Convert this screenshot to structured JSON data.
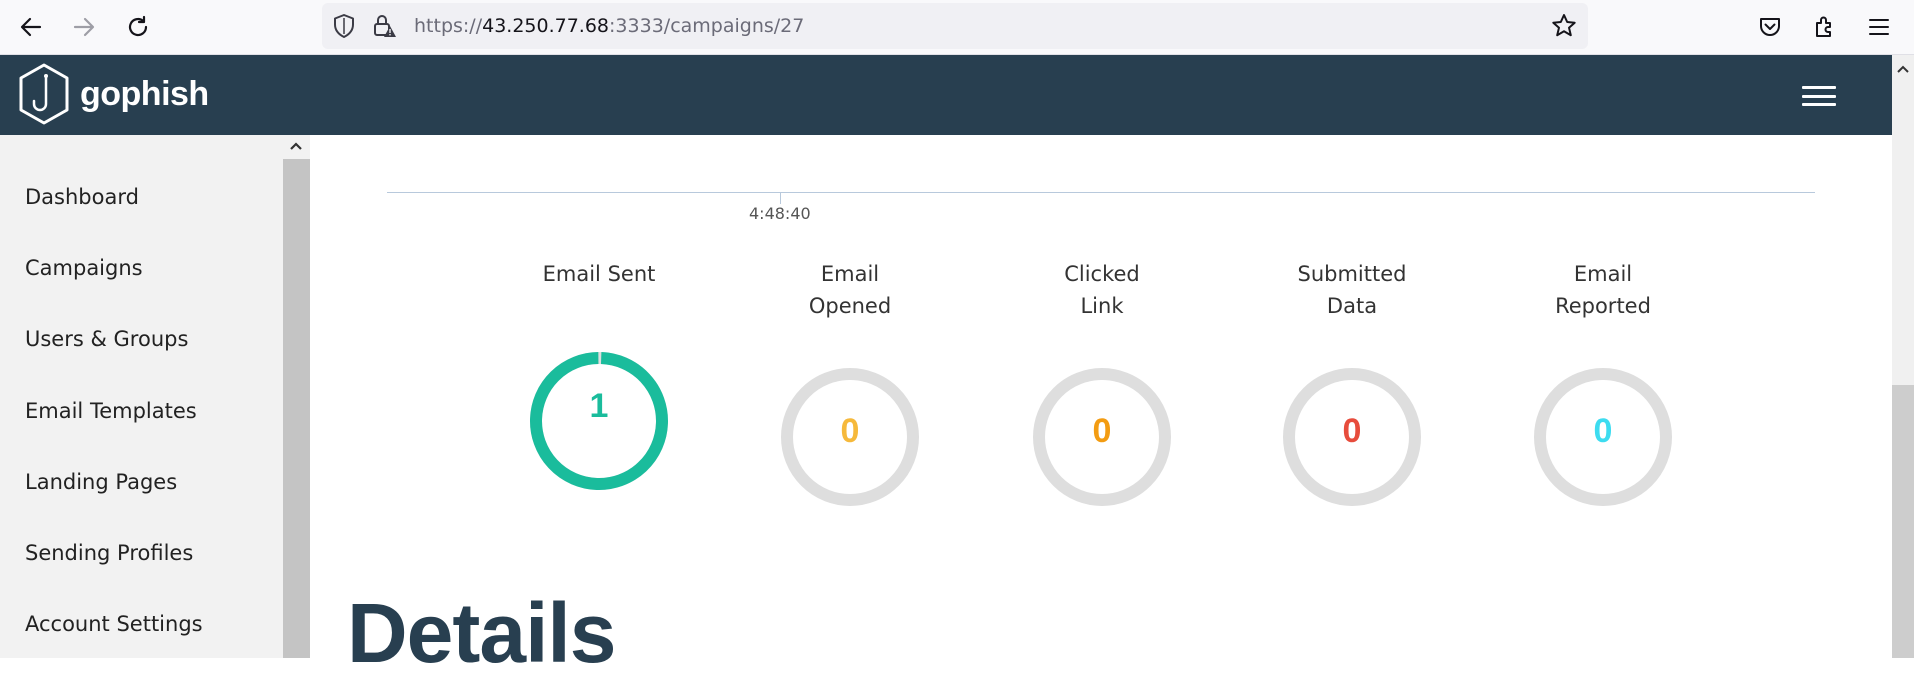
{
  "browser": {
    "url_scheme": "https://",
    "url_host": "43.250.77.68",
    "url_rest": ":3333/campaigns/27"
  },
  "app": {
    "brand": "gophish"
  },
  "sidebar": {
    "items": [
      {
        "label": "Dashboard"
      },
      {
        "label": "Campaigns"
      },
      {
        "label": "Users & Groups"
      },
      {
        "label": "Email Templates"
      },
      {
        "label": "Landing Pages"
      },
      {
        "label": "Sending Profiles"
      },
      {
        "label": "Account Settings"
      }
    ]
  },
  "timeline": {
    "tick_label": "4:48:40"
  },
  "stats": [
    {
      "label_line1": "Email Sent",
      "label_line2": "",
      "value": "1",
      "fill": 1.0,
      "color": "#1abc9c"
    },
    {
      "label_line1": "Email",
      "label_line2": "Opened",
      "value": "0",
      "fill": 0,
      "color": "#f6b93b"
    },
    {
      "label_line1": "Clicked",
      "label_line2": "Link",
      "value": "0",
      "fill": 0,
      "color": "#f39c12"
    },
    {
      "label_line1": "Submitted",
      "label_line2": "Data",
      "value": "0",
      "fill": 0,
      "color": "#e74c3c"
    },
    {
      "label_line1": "Email",
      "label_line2": "Reported",
      "value": "0",
      "fill": 0,
      "color": "#3ddcf0"
    }
  ],
  "details": {
    "heading": "Details"
  }
}
